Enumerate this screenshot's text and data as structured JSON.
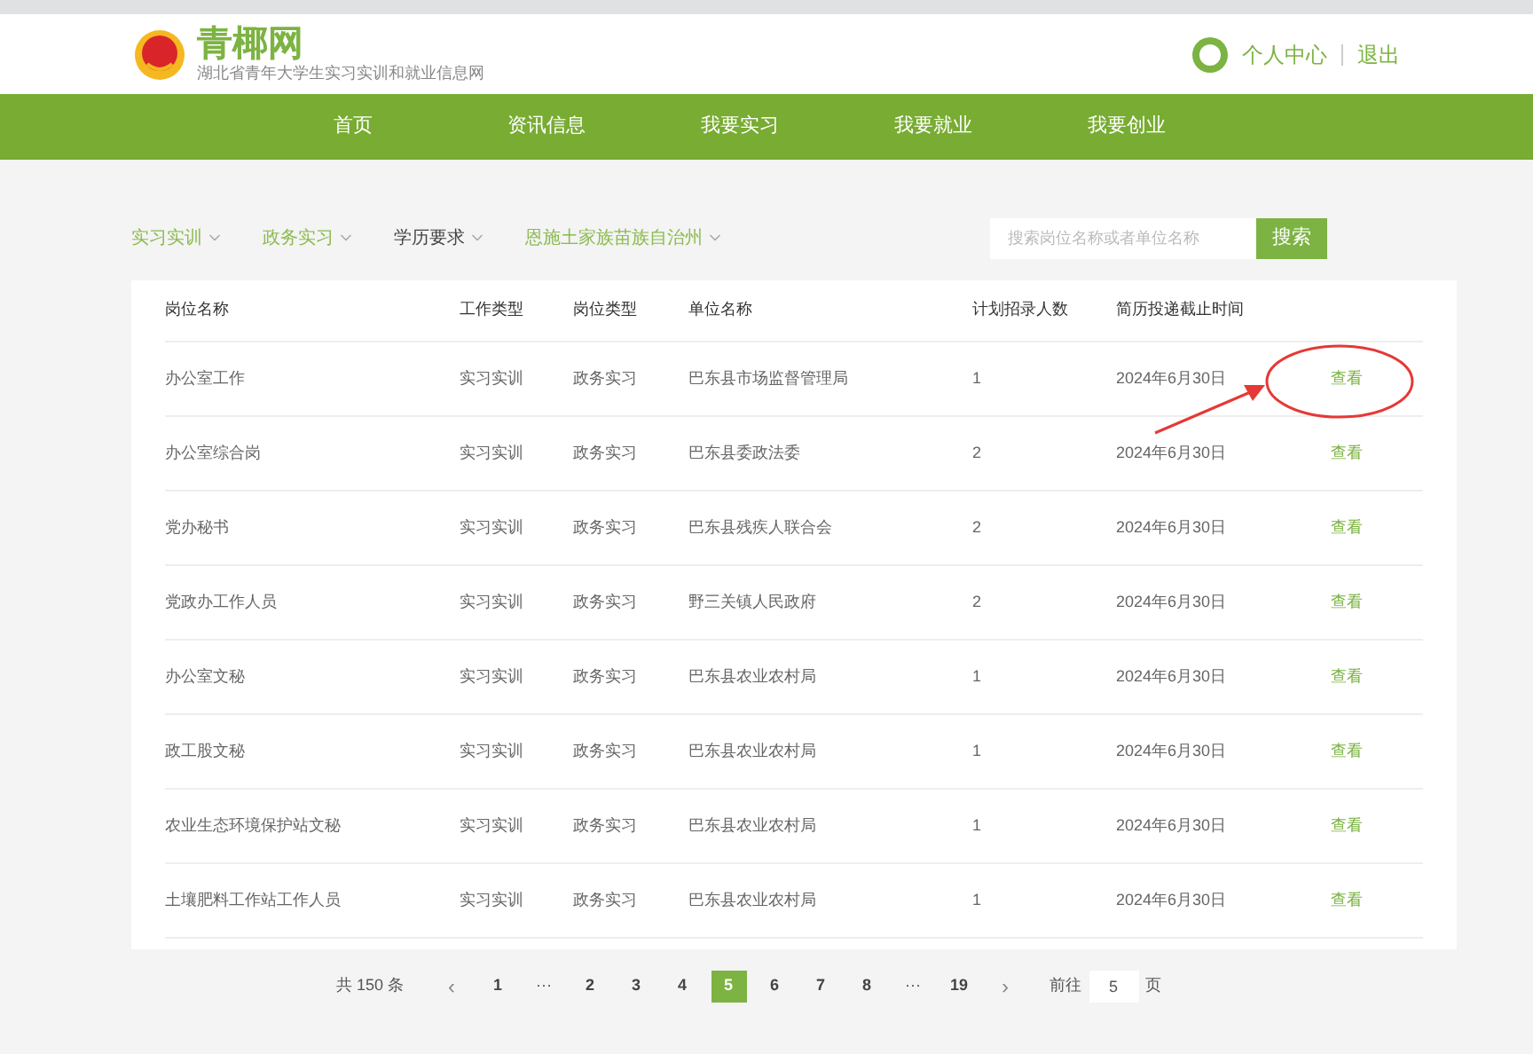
{
  "site": {
    "title": "青椰网",
    "subtitle": "湖北省青年大学生实习实训和就业信息网"
  },
  "user_links": [
    {
      "label": "个人中心"
    },
    {
      "label": "退出"
    }
  ],
  "nav": [
    {
      "label": "首页"
    },
    {
      "label": "资讯信息"
    },
    {
      "label": "我要实习"
    },
    {
      "label": "我要就业"
    },
    {
      "label": "我要创业"
    }
  ],
  "filters": [
    {
      "label": "实习实训",
      "selected": true
    },
    {
      "label": "政务实习",
      "selected": true
    },
    {
      "label": "学历要求",
      "selected": false
    },
    {
      "label": "恩施土家族苗族自治州",
      "selected": true
    }
  ],
  "search": {
    "placeholder": "搜索岗位名称或者单位名称",
    "button": "搜索"
  },
  "table": {
    "columns": [
      "岗位名称",
      "工作类型",
      "岗位类型",
      "单位名称",
      "计划招录人数",
      "简历投递截止时间"
    ],
    "rows": [
      {
        "cells": [
          "办公室工作",
          "实习实训",
          "政务实习",
          "巴东县市场监督管理局",
          "1",
          "2024年6月30日"
        ],
        "action": "查看",
        "highlighted": true
      },
      {
        "cells": [
          "办公室综合岗",
          "实习实训",
          "政务实习",
          "巴东县委政法委",
          "2",
          "2024年6月30日"
        ],
        "action": "查看",
        "highlighted": false
      },
      {
        "cells": [
          "党办秘书",
          "实习实训",
          "政务实习",
          "巴东县残疾人联合会",
          "2",
          "2024年6月30日"
        ],
        "action": "查看",
        "highlighted": false
      },
      {
        "cells": [
          "党政办工作人员",
          "实习实训",
          "政务实习",
          "野三关镇人民政府",
          "2",
          "2024年6月30日"
        ],
        "action": "查看",
        "highlighted": false
      },
      {
        "cells": [
          "办公室文秘",
          "实习实训",
          "政务实习",
          "巴东县农业农村局",
          "1",
          "2024年6月30日"
        ],
        "action": "查看",
        "highlighted": false
      },
      {
        "cells": [
          "政工股文秘",
          "实习实训",
          "政务实习",
          "巴东县农业农村局",
          "1",
          "2024年6月30日"
        ],
        "action": "查看",
        "highlighted": false
      },
      {
        "cells": [
          "农业生态环境保护站文秘",
          "实习实训",
          "政务实习",
          "巴东县农业农村局",
          "1",
          "2024年6月30日"
        ],
        "action": "查看",
        "highlighted": false
      },
      {
        "cells": [
          "土壤肥料工作站工作人员",
          "实习实训",
          "政务实习",
          "巴东县农业农村局",
          "1",
          "2024年6月30日"
        ],
        "action": "查看",
        "highlighted": false
      }
    ]
  },
  "pagination": {
    "total": "共 150 条",
    "prev": "‹",
    "next": "›",
    "pages": [
      {
        "label": "1",
        "kind": "page",
        "selected": false
      },
      {
        "label": "···",
        "kind": "more",
        "selected": false
      },
      {
        "label": "2",
        "kind": "page",
        "selected": false
      },
      {
        "label": "3",
        "kind": "page",
        "selected": false
      },
      {
        "label": "4",
        "kind": "page",
        "selected": false
      },
      {
        "label": "5",
        "kind": "page",
        "selected": true
      },
      {
        "label": "6",
        "kind": "page",
        "selected": false
      },
      {
        "label": "7",
        "kind": "page",
        "selected": false
      },
      {
        "label": "8",
        "kind": "page",
        "selected": false
      },
      {
        "label": "···",
        "kind": "more",
        "selected": false
      },
      {
        "label": "19",
        "kind": "page",
        "selected": false
      }
    ],
    "goto_prefix": "前往",
    "goto_value": "5",
    "goto_suffix": "页"
  }
}
